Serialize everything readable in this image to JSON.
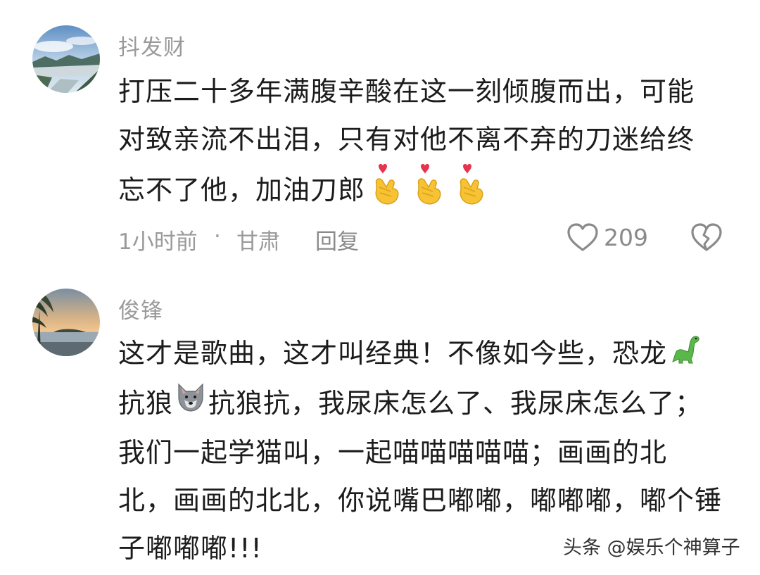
{
  "comments": [
    {
      "username": "抖发财",
      "lines": [
        "打压二十多年满腹辛酸在这一刻倾腹而出，可能",
        "对致亲流不出泪，只有对他不离不弃的刀迷给终",
        "忘不了他，加油刀郎"
      ],
      "time": "1小时前",
      "separator": "·",
      "location": "甘肃",
      "reply_label": "回复",
      "like_count": "209",
      "icons": {
        "like": "heart-outline-icon",
        "dislike": "broken-heart-icon",
        "emoji": "finger-heart-emoji"
      },
      "colors": {
        "heart_emoji": "#e8334f",
        "hand_emoji": "#f7c233"
      }
    },
    {
      "username": "俊锋",
      "lines": [
        "这才是歌曲，这才叫经典！不像如今些，恐龙",
        "抗狼",
        "抗狼抗，我尿床怎么了、我尿床怎么了；",
        "我们一起学猫叫，一起喵喵喵喵喵；画画的北",
        "北，画画的北北，你说嘴巴嘟嘟，嘟嘟嘟，嘟个锤",
        "子嘟嘟嘟!!!"
      ],
      "icons": {
        "dinosaur": "dinosaur-emoji",
        "wolf": "wolf-emoji"
      },
      "colors": {
        "dinosaur": "#5ab84a"
      }
    }
  ],
  "watermark": "头条 @娱乐个神算子"
}
